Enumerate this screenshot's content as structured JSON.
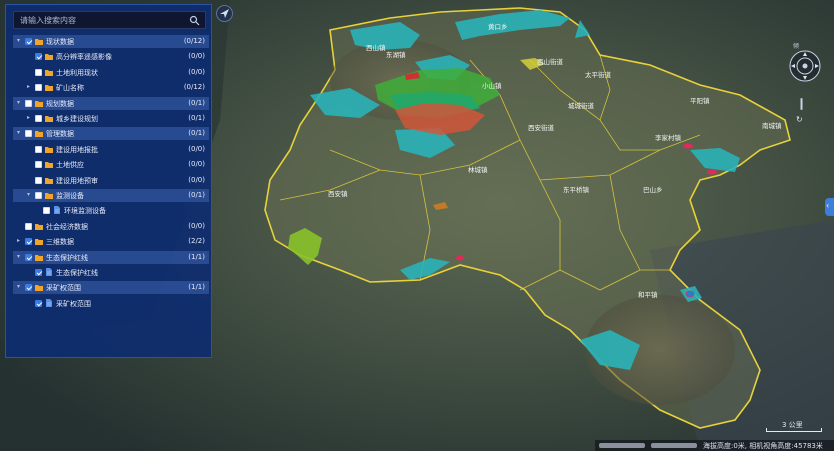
{
  "search": {
    "placeholder": "请输入搜索内容",
    "icon": "search-icon"
  },
  "tree": [
    {
      "label": "现状数据",
      "count": "(0/12)",
      "level": 0,
      "cat": true,
      "arrow": "down",
      "checked": true
    },
    {
      "label": "高分辨率遥感影像",
      "count": "(0/0)",
      "level": 1,
      "cat": false,
      "arrow": "",
      "checked": true
    },
    {
      "label": "土地利用现状",
      "count": "(0/0)",
      "level": 1,
      "cat": false,
      "arrow": "",
      "checked": false
    },
    {
      "label": "矿山名称",
      "count": "(0/12)",
      "level": 1,
      "cat": false,
      "arrow": "right",
      "checked": false
    },
    {
      "label": "规划数据",
      "count": "(0/1)",
      "level": 0,
      "cat": true,
      "arrow": "down",
      "checked": false
    },
    {
      "label": "城乡建设规划",
      "count": "(0/1)",
      "level": 1,
      "cat": false,
      "arrow": "right",
      "checked": false
    },
    {
      "label": "管理数据",
      "count": "(0/1)",
      "level": 0,
      "cat": true,
      "arrow": "down",
      "checked": false
    },
    {
      "label": "建设用地报批",
      "count": "(0/0)",
      "level": 1,
      "cat": false,
      "arrow": "",
      "checked": false
    },
    {
      "label": "土地供应",
      "count": "(0/0)",
      "level": 1,
      "cat": false,
      "arrow": "",
      "checked": false
    },
    {
      "label": "建设用地预审",
      "count": "(0/0)",
      "level": 1,
      "cat": false,
      "arrow": "",
      "checked": false
    },
    {
      "label": "监测设备",
      "count": "(0/1)",
      "level": 1,
      "cat": true,
      "arrow": "down",
      "checked": false
    },
    {
      "label": "环境监测设备",
      "count": "",
      "level": 2,
      "cat": false,
      "arrow": "",
      "checked": false,
      "file": true
    },
    {
      "label": "社会经济数据",
      "count": "(0/0)",
      "level": 0,
      "cat": false,
      "arrow": "",
      "checked": false
    },
    {
      "label": "三维数据",
      "count": "(2/2)",
      "level": 0,
      "cat": false,
      "arrow": "right",
      "checked": true
    },
    {
      "label": "生态保护红线",
      "count": "(1/1)",
      "level": 0,
      "cat": true,
      "arrow": "down",
      "checked": true
    },
    {
      "label": "生态保护红线",
      "count": "",
      "level": 1,
      "cat": false,
      "arrow": "",
      "checked": true,
      "file": true
    },
    {
      "label": "采矿权范围",
      "count": "(1/1)",
      "level": 0,
      "cat": true,
      "arrow": "down",
      "checked": true
    },
    {
      "label": "采矿权范围",
      "count": "",
      "level": 1,
      "cat": false,
      "arrow": "",
      "checked": true,
      "file": true
    }
  ],
  "map_labels": [
    {
      "id": "l1",
      "text": "黄口乡"
    },
    {
      "id": "l2",
      "text": "西山街道"
    },
    {
      "id": "l3",
      "text": "太平街道"
    },
    {
      "id": "l4",
      "text": "小山镇"
    },
    {
      "id": "l5",
      "text": "城城街道"
    },
    {
      "id": "l6",
      "text": "平阳镇"
    },
    {
      "id": "l7",
      "text": "李家村镇"
    },
    {
      "id": "l8",
      "text": "南城镇"
    },
    {
      "id": "l9",
      "text": "西安镇"
    },
    {
      "id": "l10",
      "text": "林城镇"
    },
    {
      "id": "l11",
      "text": "东平桥镇"
    },
    {
      "id": "l12",
      "text": "巴山乡"
    },
    {
      "id": "l13",
      "text": "和平镇"
    },
    {
      "id": "l14",
      "text": "西安街道"
    },
    {
      "id": "l15",
      "text": "东湖镇"
    },
    {
      "id": "l16",
      "text": "西山镇"
    }
  ],
  "controls": {
    "tilt_label": "倾",
    "reset_glyph": "↻",
    "expand_glyph": "‹"
  },
  "scale": {
    "text": "3 公里"
  },
  "status": {
    "text": "海拔高度:0米, 相机视角高度:45783米"
  },
  "colors": {
    "panel": "#0e2c70",
    "boundary": "#e8d23a",
    "eco_redline": "#2ab3b8",
    "mining": "#d0563a",
    "forest": "#3fae3a"
  }
}
